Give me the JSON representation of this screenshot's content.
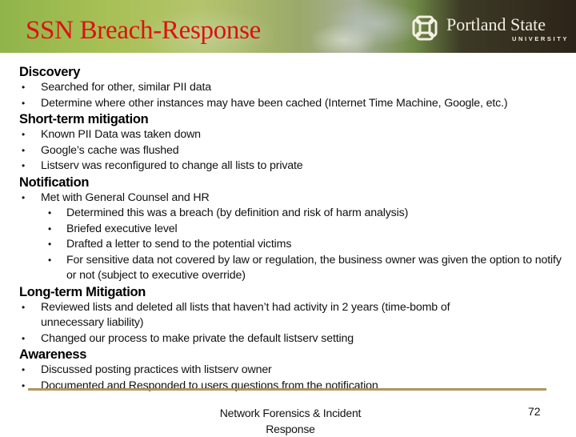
{
  "header": {
    "title": "SSN Breach-Response",
    "logo": {
      "icon": "psu-knot-icon",
      "name": "Portland State",
      "sub": "UNIVERSITY"
    },
    "title_color": "#e01010"
  },
  "sections": [
    {
      "heading": "Discovery",
      "items": [
        {
          "level": 1,
          "text": "Searched for other, similar PII data"
        },
        {
          "level": 1,
          "text": "Determine where other instances may have been cached (Internet Time Machine, Google, etc.)"
        }
      ]
    },
    {
      "heading": "Short-term mitigation",
      "items": [
        {
          "level": 1,
          "text": "Known PII Data was taken down"
        },
        {
          "level": 1,
          "text": "Google’s cache was flushed"
        },
        {
          "level": 1,
          "text": "Listserv was reconfigured to change all lists to private"
        }
      ]
    },
    {
      "heading": "Notification",
      "items": [
        {
          "level": 1,
          "text": "Met with General Counsel and HR"
        },
        {
          "level": 2,
          "text": "Determined this was a breach (by definition and risk of harm analysis)"
        },
        {
          "level": 2,
          "text": "Briefed executive level"
        },
        {
          "level": 2,
          "text": "Drafted a letter to send to the potential victims"
        },
        {
          "level": 2,
          "text": "For sensitive data not covered by law or regulation, the business owner was given the option to notify or not (subject to executive override)"
        }
      ]
    },
    {
      "heading": "Long-term Mitigation",
      "items": [
        {
          "level": 1,
          "text": "Reviewed lists and deleted all lists that haven’t had activity in 2 years (time-bomb of unnecessary liability)"
        },
        {
          "level": 1,
          "text": "Changed our process to make private the default listserv setting"
        }
      ]
    },
    {
      "heading": "Awareness",
      "items": [
        {
          "level": 1,
          "text": "Discussed posting practices with listserv owner"
        },
        {
          "level": 1,
          "text": "Documented and Responded to users questions from the notification"
        }
      ]
    }
  ],
  "bullet_glyph": "•",
  "footer": {
    "text": "Network Forensics & Incident Response",
    "page_number": "72",
    "divider_color": "#b09660"
  }
}
